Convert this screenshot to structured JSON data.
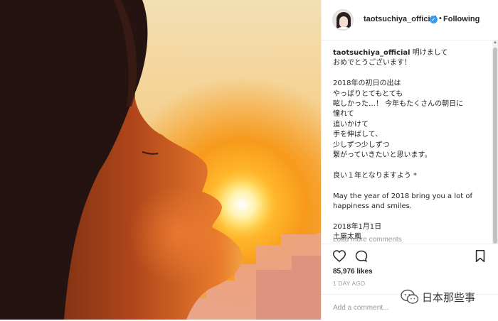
{
  "post": {
    "username": "taotsuchiya_official",
    "verified_icon": "verified-badge-icon",
    "separator": "•",
    "follow_status": "Following",
    "caption_user": "taotsuchiya_official",
    "caption_text": " 明けまして\nおめでとうございます！\n\n2018年の初日の出は\nやっぱりとてもとても\n眩しかった…！ 今年もたくさんの朝日に\n憧れて\n追いかけて\n手を伸ばして、\n少しずつ少しずつ\n繋がっていきたいと思います。\n\n良い１年となりますよう *\n\nMay the year of 2018 bring you a lot of\nhappiness and smiles.\n\n2018年1月1日\n土屋太鳳",
    "load_more": "Load more comments",
    "likes": "85,976 likes",
    "date": "1 DAY AGO",
    "comment_placeholder": "Add a comment..."
  },
  "icons": {
    "like": "heart-icon",
    "comment": "comment-bubble-icon",
    "save": "bookmark-icon"
  },
  "watermark": {
    "text": "日本那些事"
  },
  "colors": {
    "accent_blue": "#3897f0",
    "text": "#262626",
    "muted": "#999999"
  }
}
